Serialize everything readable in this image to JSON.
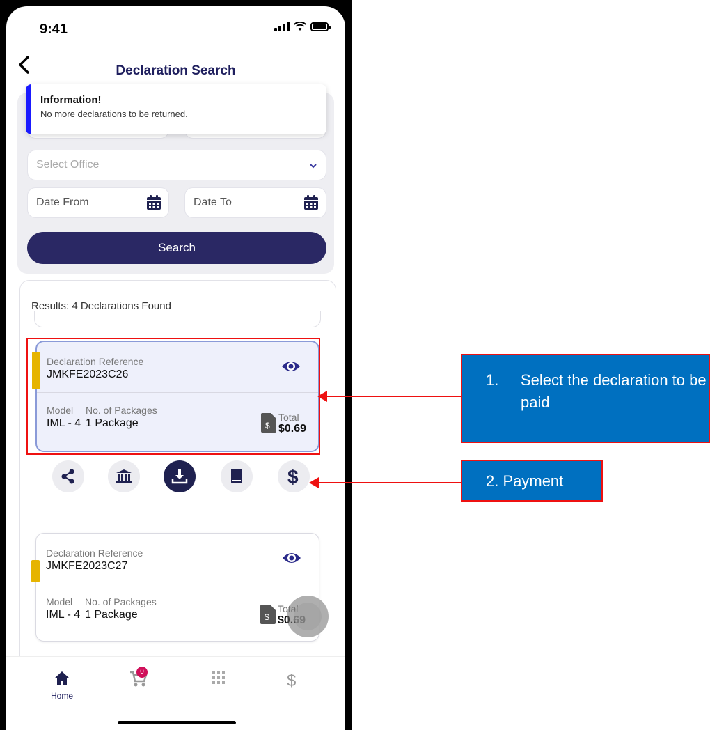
{
  "status_bar": {
    "time": "9:41"
  },
  "header": {
    "title": "Declaration Search"
  },
  "toast": {
    "title": "Information!",
    "message": "No more declarations to be returned."
  },
  "form": {
    "office_placeholder": "Select Office",
    "date_from": "Date From",
    "date_to": "Date To",
    "search_label": "Search"
  },
  "results": {
    "label": "Results: 4 Declarations Found",
    "cards": [
      {
        "ref_label": "Declaration Reference",
        "ref": "JMKFE2023C26",
        "model_label": "Model",
        "model": "IML - 4",
        "packages_label": "No. of Packages",
        "packages": "1 Package",
        "total_label": "Total",
        "total": "$0.69"
      },
      {
        "ref_label": "Declaration Reference",
        "ref": "JMKFE2023C27",
        "model_label": "Model",
        "model": "IML - 4",
        "packages_label": "No. of Packages",
        "packages": "1 Package",
        "total_label": "Total",
        "total": "$0.69"
      }
    ]
  },
  "tabbar": {
    "home_label": "Home",
    "cart_badge": "0"
  },
  "annotations": {
    "step1_number": "1.",
    "step1_text": "Select the declaration to be paid",
    "step2_text": "2. Payment"
  },
  "colors": {
    "navy": "#2a2864",
    "accent_stripe": "#e6b400",
    "callout_blue": "#0070c0",
    "callout_border": "#e11111"
  }
}
